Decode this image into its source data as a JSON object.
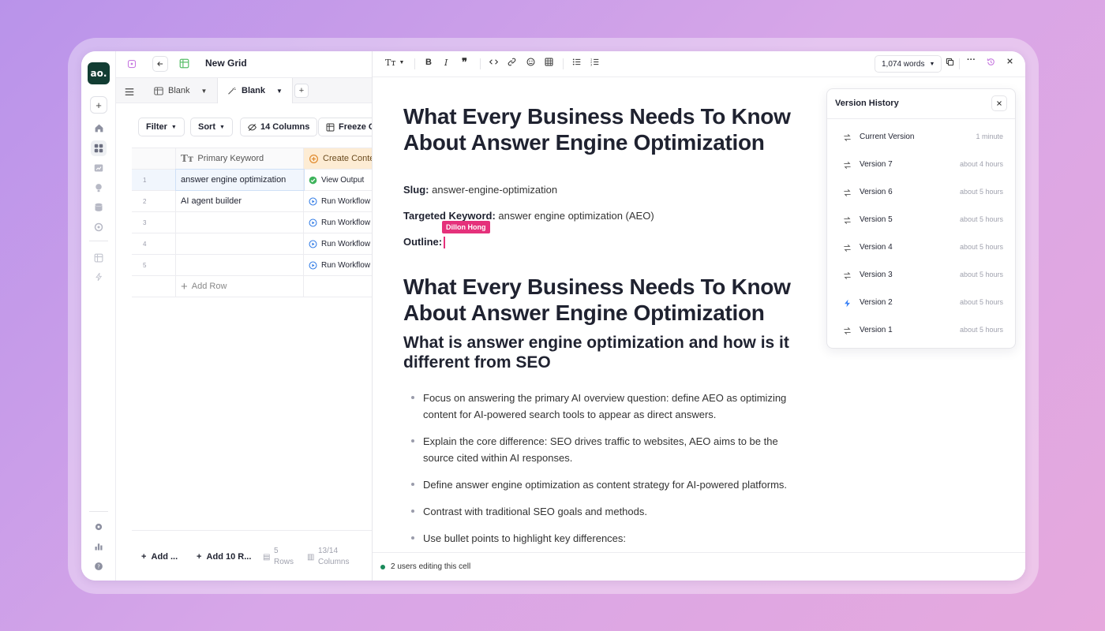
{
  "rail": {
    "logo_text": "ao.",
    "add_label": "+",
    "icons": [
      "home-icon",
      "grid-icon",
      "chart-icon",
      "bulb-icon",
      "database-icon",
      "integrations-icon",
      "table-icon",
      "bolt-icon",
      "gear-icon",
      "bar-chart-icon",
      "help-icon"
    ]
  },
  "grid": {
    "title": "New Grid",
    "tabs": [
      {
        "label": "Blank",
        "active": false
      },
      {
        "label": "Blank",
        "active": true
      }
    ],
    "add_tab_label": "+",
    "toolbar": {
      "filter": "Filter",
      "sort": "Sort",
      "columns": "14 Columns",
      "freeze": "Freeze Co"
    },
    "columns": {
      "keyword": "Primary Keyword",
      "content": "Create Conte"
    },
    "rows": [
      {
        "num": "1",
        "keyword": "answer engine optimization",
        "status": "View Output",
        "done": true
      },
      {
        "num": "2",
        "keyword": "AI agent builder",
        "status": "Run Workflow",
        "done": false
      },
      {
        "num": "3",
        "keyword": "",
        "status": "Run Workflow",
        "done": false
      },
      {
        "num": "4",
        "keyword": "",
        "status": "Run Workflow",
        "done": false
      },
      {
        "num": "5",
        "keyword": "",
        "status": "Run Workflow",
        "done": false
      }
    ],
    "add_row_label": "Add Row",
    "footer": {
      "add": "Add ...",
      "add10": "Add 10 R...",
      "rows_count": "5",
      "rows_label": "Rows",
      "cols_count": "13/14",
      "cols_label": "Columns"
    }
  },
  "editor": {
    "word_count": "1,074 words",
    "doc": {
      "title": "What Every Business Needs To Know About Answer Engine Optimization",
      "slug_label": "Slug:",
      "slug_value": "answer-engine-optimization",
      "keyword_label": "Targeted Keyword:",
      "keyword_value": "answer engine optimization (AEO)",
      "outline_label": "Outline:",
      "cursor_user": "Dillon Hong",
      "heading2": "What Every Business Needs To Know About Answer Engine Optimization",
      "subheading": "What is answer engine optimization and how is it different from SEO",
      "bullets": [
        "Focus on answering the primary AI overview question: define AEO as optimizing content for AI-powered search tools to appear as direct answers.",
        "Explain the core difference: SEO drives traffic to websites, AEO aims to be the source cited within AI responses.",
        "Define answer engine optimization as content strategy for AI-powered platforms.",
        "Contrast with traditional SEO goals and methods.",
        "Use bullet points to highlight key differences:"
      ]
    },
    "status_text": "2 users editing this cell",
    "colors": {
      "accent_pink": "#e5317b",
      "brand_green": "#123d33",
      "status_green": "#1a8a5a"
    }
  },
  "version_history": {
    "title": "Version History",
    "versions": [
      {
        "name": "Current Version",
        "time": "1 minute",
        "icon": "restore-icon"
      },
      {
        "name": "Version 7",
        "time": "about 4 hours",
        "icon": "restore-icon"
      },
      {
        "name": "Version 6",
        "time": "about 5 hours",
        "icon": "restore-icon"
      },
      {
        "name": "Version 5",
        "time": "about 5 hours",
        "icon": "restore-icon"
      },
      {
        "name": "Version 4",
        "time": "about 5 hours",
        "icon": "restore-icon"
      },
      {
        "name": "Version 3",
        "time": "about 5 hours",
        "icon": "restore-icon"
      },
      {
        "name": "Version 2",
        "time": "about 5 hours",
        "icon": "bolt-icon"
      },
      {
        "name": "Version 1",
        "time": "about 5 hours",
        "icon": "restore-icon"
      }
    ]
  }
}
